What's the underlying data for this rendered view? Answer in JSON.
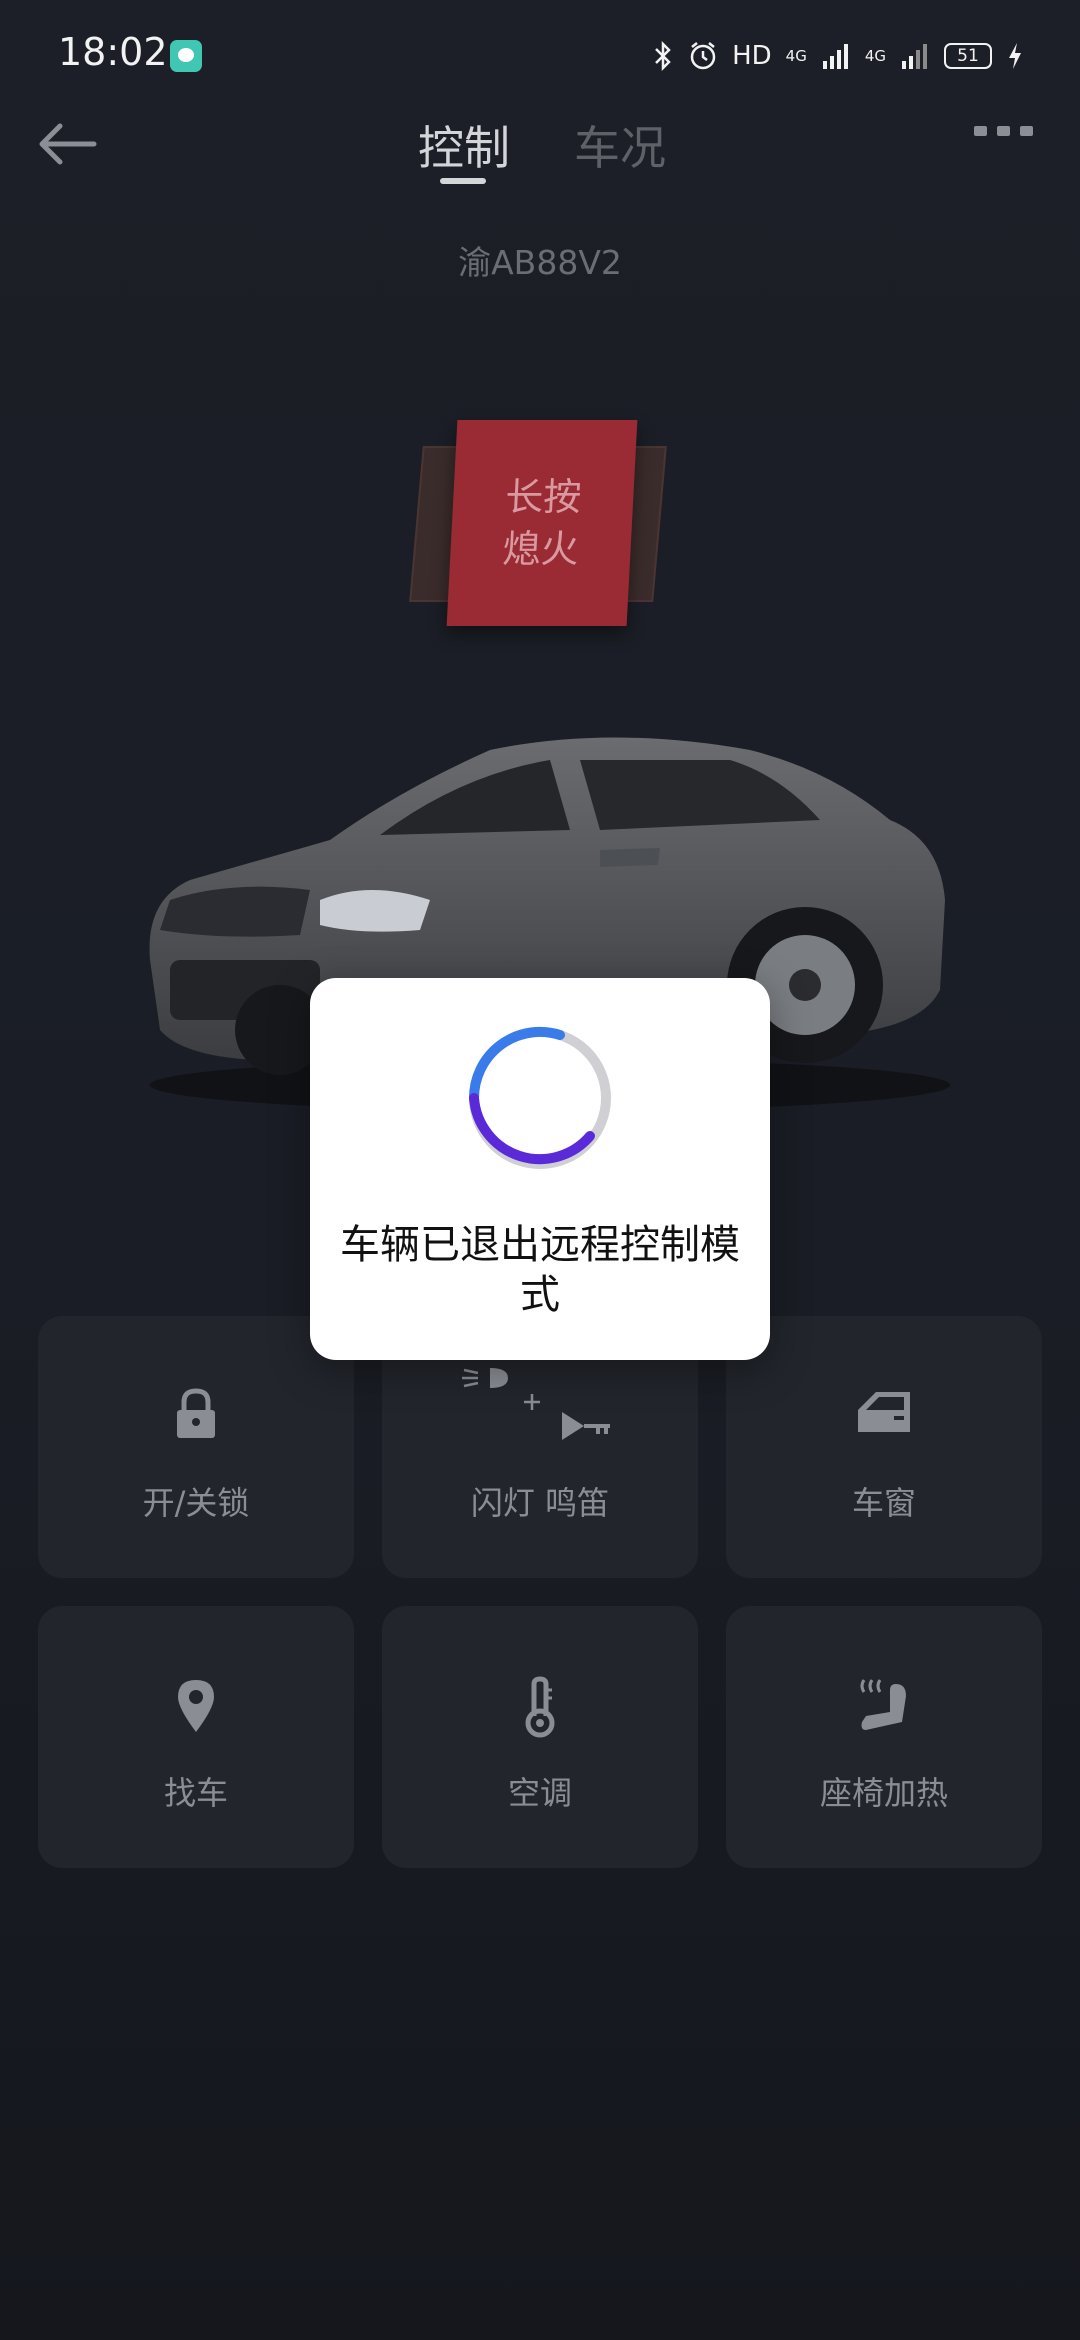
{
  "status_bar": {
    "time": "18:02",
    "hd": "HD",
    "net1": "4G",
    "net2": "4G",
    "battery": "51"
  },
  "header": {
    "tabs": [
      {
        "label": "控制",
        "active": true
      },
      {
        "label": "车况",
        "active": false
      }
    ]
  },
  "vehicle": {
    "plate": "渝AB88V2",
    "engine_button": {
      "line1": "长按",
      "line2": "熄火",
      "color": "#9a2a33"
    }
  },
  "controls": [
    {
      "label": "开/关锁",
      "icon": "lock-icon"
    },
    {
      "label": "闪灯 鸣笛",
      "icon": "flash-horn-icon"
    },
    {
      "label": "车窗",
      "icon": "car-window-icon"
    },
    {
      "label": "找车",
      "icon": "location-pin-icon"
    },
    {
      "label": "空调",
      "icon": "thermometer-icon"
    },
    {
      "label": "座椅加热",
      "icon": "seat-heat-icon"
    }
  ],
  "dialog": {
    "message": "车辆已退出远程控制模式",
    "spinner_colors": {
      "primary": "#3a7bea",
      "secondary": "#5a2ad8",
      "track": "#d0d0d4"
    }
  },
  "colors": {
    "background": "#1a1d24",
    "card": "#22252c",
    "text_muted": "#8a8d93"
  }
}
